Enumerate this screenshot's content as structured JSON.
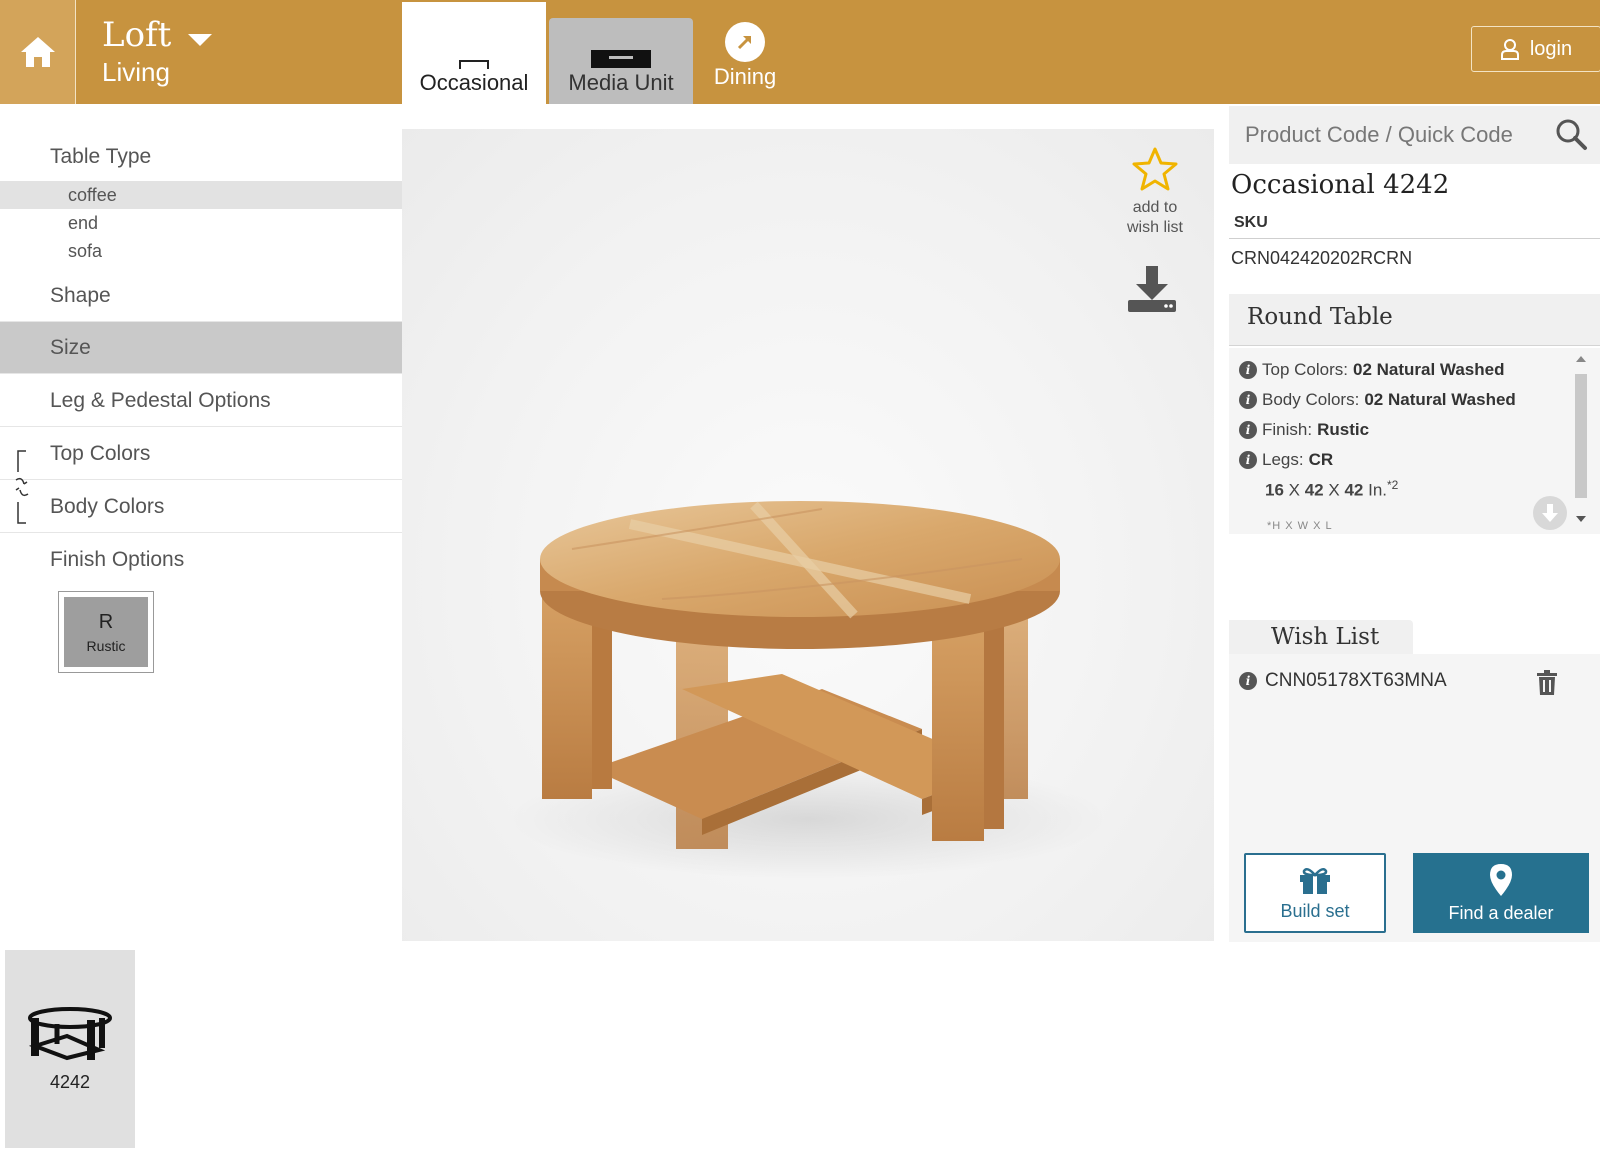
{
  "header": {
    "brand_name": "Loft",
    "brand_sub": "Living",
    "tabs": [
      {
        "label": "Occasional",
        "active": true
      },
      {
        "label": "Media Unit",
        "active": false
      },
      {
        "label": "Dining",
        "active": false
      }
    ],
    "login_label": "login"
  },
  "sidebar": {
    "table_type_label": "Table Type",
    "table_types": [
      {
        "label": "coffee",
        "selected": true
      },
      {
        "label": "end",
        "selected": false
      },
      {
        "label": "sofa",
        "selected": false
      }
    ],
    "categories": [
      "Shape",
      "Size",
      "Leg & Pedestal Options",
      "Top Colors",
      "Body Colors",
      "Finish Options"
    ],
    "finish": {
      "code": "R",
      "label": "Rustic"
    }
  },
  "viewer": {
    "wish_add_label_1": "add to",
    "wish_add_label_2": "wish list"
  },
  "search": {
    "placeholder": "Product Code / Quick Code"
  },
  "product": {
    "title": "Occasional 4242",
    "sku_label": "SKU",
    "sku_value": "CRN042420202RCRN",
    "spec_title": "Round Table",
    "specs": [
      {
        "label": "Top Colors:",
        "value": "02 Natural Washed"
      },
      {
        "label": "Body Colors:",
        "value": "02 Natural Washed"
      },
      {
        "label": "Finish:",
        "value": "Rustic"
      },
      {
        "label": "Legs:",
        "value": "CR"
      }
    ],
    "dims": {
      "h": "16",
      "w": "42",
      "l": "42",
      "unit": "In.",
      "note_sup": "*2",
      "note": "*H X W X L"
    }
  },
  "wishlist": {
    "title": "Wish List",
    "items": [
      "CNN05178XT63MNA"
    ],
    "build_label": "Build set",
    "dealer_label": "Find a dealer"
  },
  "thumbnails": [
    {
      "label": "4242"
    }
  ],
  "colors": {
    "header": "#c7933f",
    "accent": "#26718f",
    "selected_row": "#c9c9c9",
    "star": "#f0b400"
  },
  "icons": {
    "home": "home-icon",
    "search": "search-icon",
    "user": "user-icon",
    "star": "star-icon",
    "download": "download-icon",
    "info": "info-icon",
    "trash": "trash-icon",
    "gift": "gift-icon",
    "pin": "map-pin-icon"
  }
}
